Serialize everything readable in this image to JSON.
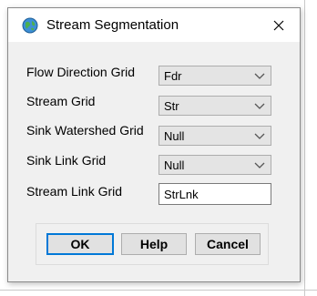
{
  "dialog": {
    "title": "Stream Segmentation",
    "icon": "globe-icon",
    "close_icon": "close-icon"
  },
  "fields": [
    {
      "label": "Flow Direction Grid",
      "value": "Fdr",
      "type": "combo"
    },
    {
      "label": "Stream Grid",
      "value": "Str",
      "type": "combo"
    },
    {
      "label": "Sink Watershed Grid",
      "value": "Null",
      "type": "combo"
    },
    {
      "label": "Sink Link Grid",
      "value": "Null",
      "type": "combo"
    },
    {
      "label": "Stream Link Grid",
      "value": "StrLnk",
      "type": "text"
    }
  ],
  "buttons": {
    "ok": "OK",
    "help": "Help",
    "cancel": "Cancel"
  },
  "colors": {
    "accent": "#0078d7",
    "dialog_bg": "#f0f0f0"
  }
}
